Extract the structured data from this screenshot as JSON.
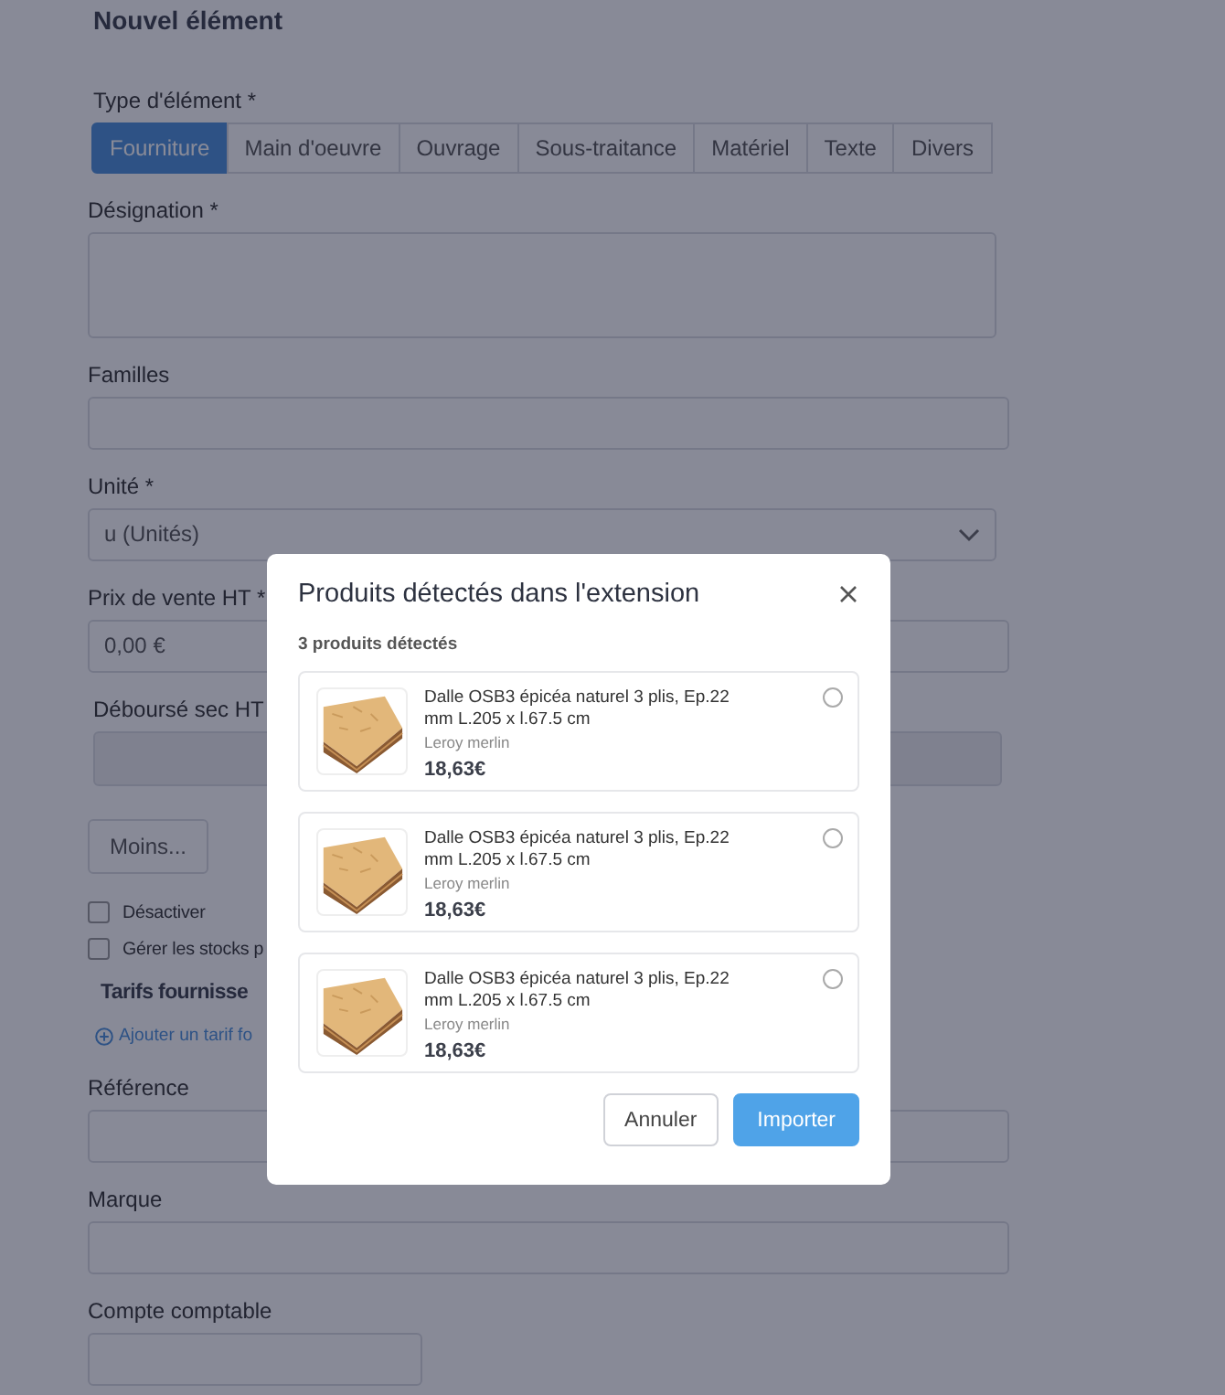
{
  "title": "Nouvel élément",
  "type_label": "Type d'élément *",
  "tabs": [
    {
      "label": "Fourniture",
      "selected": true
    },
    {
      "label": "Main d'oeuvre",
      "selected": false
    },
    {
      "label": "Ouvrage",
      "selected": false
    },
    {
      "label": "Sous-traitance",
      "selected": false
    },
    {
      "label": "Matériel",
      "selected": false
    },
    {
      "label": "Texte",
      "selected": false
    },
    {
      "label": "Divers",
      "selected": false
    }
  ],
  "form": [
    {
      "kind": "textarea",
      "label": "Désignation  *",
      "disabled": false
    },
    {
      "kind": "input",
      "label": "Familles",
      "disabled": false
    },
    {
      "kind": "select",
      "label": "Unité *",
      "value": "u (Unités)",
      "disabled": false
    },
    {
      "kind": "input",
      "label": "Prix de vente HT *",
      "value": "0,00 €",
      "disabled": false
    },
    {
      "kind": "input",
      "label": "Déboursé sec HT",
      "disabled": true
    },
    {
      "kind": "button",
      "label": "Moins..."
    },
    {
      "kind": "checkbox",
      "label": "Désactiver",
      "checked": false
    },
    {
      "kind": "checkbox",
      "label": "Gérer les stocks p",
      "checked": false
    },
    {
      "kind": "heading",
      "label": "Tarifs fournisse"
    },
    {
      "kind": "link",
      "label": "Ajouter un tarif fo"
    },
    {
      "kind": "input",
      "label": "Référence",
      "disabled": false
    },
    {
      "kind": "input",
      "label": "Marque",
      "disabled": false
    },
    {
      "kind": "short-input",
      "label": "Compte comptable",
      "disabled": false
    }
  ],
  "modal": {
    "title": "Produits détectés dans l'extension",
    "count": "3 produits détectés",
    "products": [
      {
        "name": "Dalle OSB3 épicéa naturel 3 plis, Ep.22 mm L.205 x l.67.5 cm",
        "seller": "Leroy merlin",
        "price": "18,63€",
        "selected": false
      },
      {
        "name": "Dalle OSB3 épicéa naturel 3 plis, Ep.22 mm L.205 x l.67.5 cm",
        "seller": "Leroy merlin",
        "price": "18,63€",
        "selected": false
      },
      {
        "name": "Dalle OSB3 épicéa naturel 3 plis, Ep.22 mm L.205 x l.67.5 cm",
        "seller": "Leroy merlin",
        "price": "18,63€",
        "selected": false
      }
    ],
    "buttons": [
      {
        "label": "Annuler",
        "kind": "secondary",
        "disabled": false
      },
      {
        "label": "Importer",
        "kind": "primary",
        "disabled": true
      }
    ]
  }
}
